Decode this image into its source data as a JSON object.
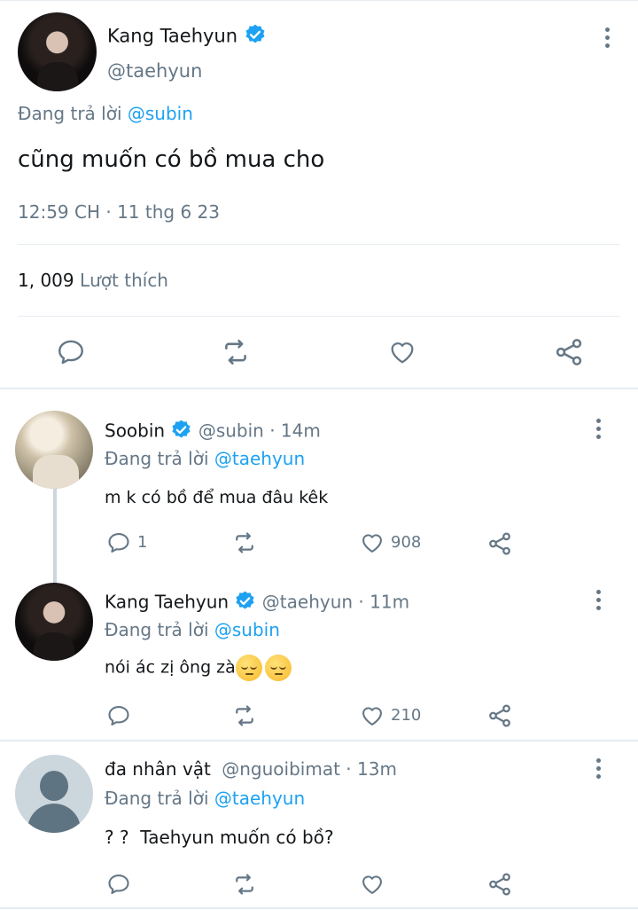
{
  "main_tweet": {
    "display_name": "Kang Taehyun",
    "handle": "@taehyun",
    "reply_prefix": "Đang trả lời",
    "reply_to": "@subin",
    "text": "cũng muốn có bồ mua cho",
    "timestamp": "12:59 CH · 11 thg 6 23",
    "likes_count": "1, 009",
    "likes_label": "Lượt thích"
  },
  "replies": [
    {
      "display_name": "Soobin",
      "verified": true,
      "handle": "@subin",
      "time": "· 14m",
      "reply_prefix": "Đang trả lời",
      "reply_to": "@taehyun",
      "text": "m k có bồ để mua đâu kêk",
      "reply_count": "1",
      "like_count": "908"
    },
    {
      "display_name": "Kang Taehyun",
      "verified": true,
      "handle": "@taehyun",
      "time": "· 11m",
      "reply_prefix": "Đang trả lời",
      "reply_to": "@subin",
      "text": "nói ác zị ông zà",
      "emojis": [
        "pensive-face",
        "pensive-face"
      ],
      "reply_count": "",
      "like_count": "210"
    },
    {
      "display_name": "đa nhân vật",
      "verified": false,
      "handle": "@nguoibimat",
      "time": "· 13m",
      "reply_prefix": "Đang trả lời",
      "reply_to": "@taehyun",
      "text": "? ?  Taehyun muốn có bồ?",
      "reply_count": "",
      "like_count": ""
    }
  ],
  "colors": {
    "accent": "#1da1f2",
    "text": "#14171a",
    "muted": "#657786",
    "divider": "#e6ecf0"
  },
  "icons": [
    "verified-badge-icon",
    "more-icon",
    "reply-icon",
    "retweet-icon",
    "like-icon",
    "share-icon"
  ]
}
